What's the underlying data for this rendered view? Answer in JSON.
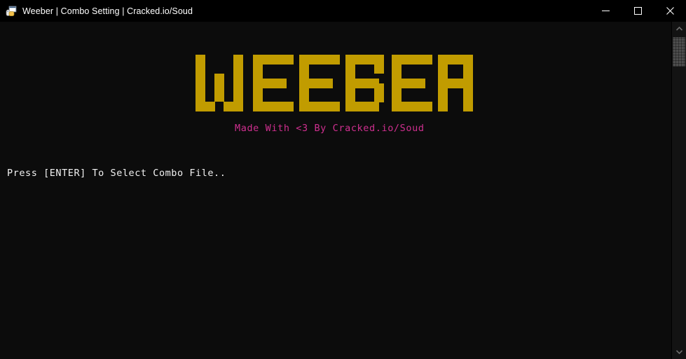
{
  "window": {
    "title": "Weeber | Combo Setting | Cracked.io/Soud",
    "app_icon": "python-window-icon",
    "controls": {
      "minimize": "minimize-icon",
      "maximize": "maximize-icon",
      "close": "close-icon"
    }
  },
  "console": {
    "banner_text": "WEEBER",
    "banner_color": "#c19c00",
    "subtitle": "Made With <3 By Cracked.io/Soud",
    "subtitle_color": "#cf2f8f",
    "prompt": "Press [ENTER] To Select Combo File..",
    "prompt_color": "#f2f2f2",
    "background_color": "#0c0c0c"
  },
  "scrollbar": {
    "up_arrow": "chevron-up-icon",
    "down_arrow": "chevron-down-icon",
    "thumb": "scrollbar-thumb"
  }
}
